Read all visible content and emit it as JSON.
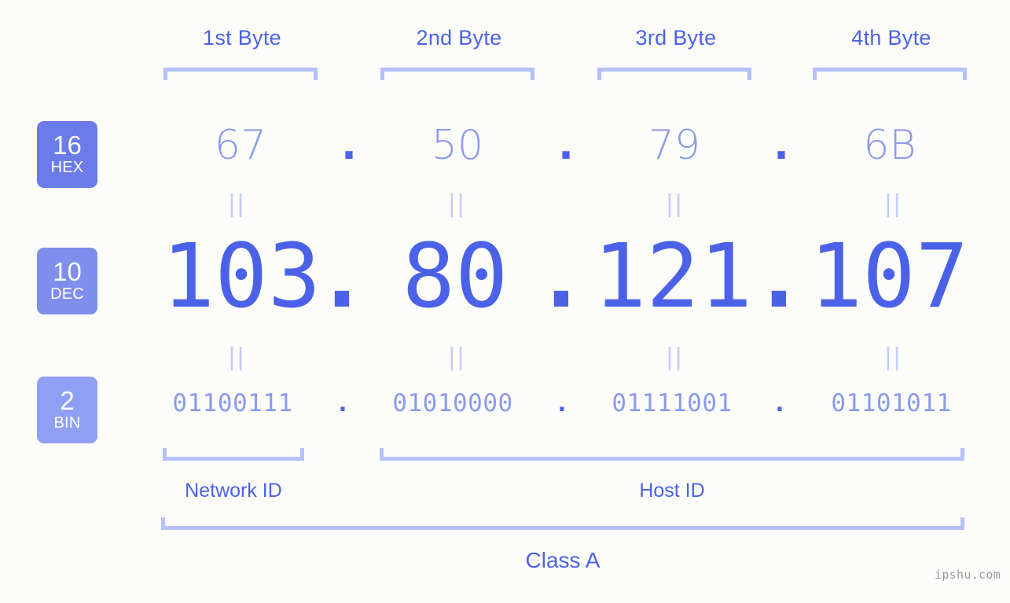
{
  "watermark": "ipshu.com",
  "byte_headers": [
    {
      "label": "1st Byte"
    },
    {
      "label": "2nd Byte"
    },
    {
      "label": "3rd Byte"
    },
    {
      "label": "4th Byte"
    }
  ],
  "bases": [
    {
      "num": "16",
      "abbr": "HEX",
      "color": "#6b7bea"
    },
    {
      "num": "10",
      "abbr": "DEC",
      "color": "#7f8ded"
    },
    {
      "num": "2",
      "abbr": "BIN",
      "color": "#8fa0f4"
    }
  ],
  "separator": ".",
  "equals_mark": "||",
  "rows": {
    "hex": {
      "values": [
        "67",
        "50",
        "79",
        "6B"
      ]
    },
    "dec": {
      "values": [
        "103",
        "80",
        "121",
        "107"
      ]
    },
    "bin": {
      "values": [
        "01100111",
        "01010000",
        "01111001",
        "01101011"
      ]
    }
  },
  "id_sections": [
    {
      "label": "Network ID"
    },
    {
      "label": "Host ID"
    }
  ],
  "class_label": "Class A",
  "colors": {
    "background": "#fcfdfa",
    "accent_strong": "#4b62e8",
    "accent_light": "#8b9aec",
    "bracket": "#b6c0fb",
    "equals": "#c2cbfb",
    "watermark": "#9b9b9b"
  }
}
